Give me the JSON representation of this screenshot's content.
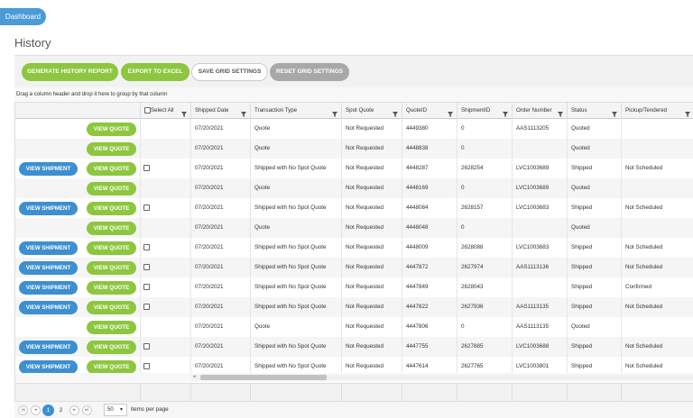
{
  "nav": {
    "dashboard_label": "Dashboard"
  },
  "page": {
    "title": "History"
  },
  "toolbar": {
    "generate_label": "Generate History Report",
    "export_label": "Export to Excel",
    "save_label": "Save Grid Settings",
    "reset_label": "Reset Grid Settings"
  },
  "grid": {
    "group_hint": "Drag a column header and drop it here to group by that column",
    "select_all_label": "Select All",
    "columns": [
      "Shipped Date",
      "Transaction Type",
      "Spot Quote",
      "QuoteID",
      "ShipmentID",
      "Order Number",
      "Status",
      "Pickup/Tendered"
    ],
    "view_shipment_label": "VIEW SHIPMENT",
    "view_quote_label": "VIEW QUOTE",
    "rows": [
      {
        "has_shipment": false,
        "date": "07/20/2021",
        "type": "Quote",
        "spot": "Not Requested",
        "quote_id": "4449380",
        "shipment_id": "0",
        "order": "AAS1113205",
        "status": "Quoted",
        "pickup": ""
      },
      {
        "has_shipment": false,
        "date": "07/20/2021",
        "type": "Quote",
        "spot": "Not Requested",
        "quote_id": "4448838",
        "shipment_id": "0",
        "order": "",
        "status": "Quoted",
        "pickup": ""
      },
      {
        "has_shipment": true,
        "date": "07/20/2021",
        "type": "Shipped with No Spot Quote",
        "spot": "Not Requested",
        "quote_id": "4448287",
        "shipment_id": "2628254",
        "order": "LVC1003689",
        "status": "Shipped",
        "pickup": "Not Scheduled"
      },
      {
        "has_shipment": false,
        "date": "07/20/2021",
        "type": "Quote",
        "spot": "Not Requested",
        "quote_id": "4448169",
        "shipment_id": "0",
        "order": "LVC1003689",
        "status": "Quoted",
        "pickup": ""
      },
      {
        "has_shipment": true,
        "date": "07/20/2021",
        "type": "Shipped with No Spot Quote",
        "spot": "Not Requested",
        "quote_id": "4448084",
        "shipment_id": "2628157",
        "order": "LVC1003683",
        "status": "Shipped",
        "pickup": "Not Scheduled"
      },
      {
        "has_shipment": false,
        "date": "07/20/2021",
        "type": "Quote",
        "spot": "Not Requested",
        "quote_id": "4448048",
        "shipment_id": "0",
        "order": "",
        "status": "Quoted",
        "pickup": ""
      },
      {
        "has_shipment": true,
        "date": "07/20/2021",
        "type": "Shipped with No Spot Quote",
        "spot": "Not Requested",
        "quote_id": "4448009",
        "shipment_id": "2628088",
        "order": "LVC1003683",
        "status": "Shipped",
        "pickup": "Not Scheduled"
      },
      {
        "has_shipment": true,
        "date": "07/20/2021",
        "type": "Shipped with No Spot Quote",
        "spot": "Not Requested",
        "quote_id": "4447872",
        "shipment_id": "2627974",
        "order": "AAS1113136",
        "status": "Shipped",
        "pickup": "Not Scheduled"
      },
      {
        "has_shipment": true,
        "date": "07/20/2021",
        "type": "Shipped with No Spot Quote",
        "spot": "Not Requested",
        "quote_id": "4447849",
        "shipment_id": "2628043",
        "order": "",
        "status": "Shipped",
        "pickup": "Confirmed"
      },
      {
        "has_shipment": true,
        "date": "07/20/2021",
        "type": "Shipped with No Spot Quote",
        "spot": "Not Requested",
        "quote_id": "4447822",
        "shipment_id": "2627936",
        "order": "AAS1113135",
        "status": "Shipped",
        "pickup": "Not Scheduled"
      },
      {
        "has_shipment": false,
        "date": "07/20/2021",
        "type": "Quote",
        "spot": "Not Requested",
        "quote_id": "4447806",
        "shipment_id": "0",
        "order": "AAS1113135",
        "status": "Quoted",
        "pickup": ""
      },
      {
        "has_shipment": true,
        "date": "07/20/2021",
        "type": "Shipped with No Spot Quote",
        "spot": "Not Requested",
        "quote_id": "4447755",
        "shipment_id": "2627885",
        "order": "LVC1003688",
        "status": "Shipped",
        "pickup": "Not Scheduled"
      },
      {
        "has_shipment": true,
        "date": "07/20/2021",
        "type": "Shipped with No Spot Quote",
        "spot": "Not Requested",
        "quote_id": "4447614",
        "shipment_id": "2627765",
        "order": "LVC1003801",
        "status": "Shipped",
        "pickup": "Not Scheduled"
      }
    ]
  },
  "pager": {
    "pages": [
      "1",
      "2"
    ],
    "current_page": "1",
    "page_size": "50",
    "page_size_label": "items per page"
  },
  "icons": {
    "filter": "filter-icon",
    "first": "first-page-icon",
    "prev": "prev-page-icon",
    "next": "next-page-icon",
    "last": "last-page-icon"
  },
  "colors": {
    "accent_blue": "#3d8fd0",
    "accent_green": "#8dc63f"
  }
}
